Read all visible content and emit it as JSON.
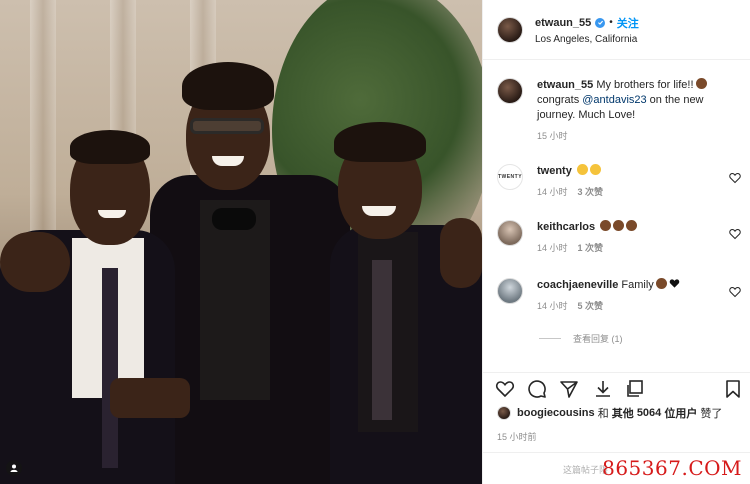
{
  "header": {
    "username": "etwaun_55",
    "follow_label": "关注",
    "location": "Los Angeles, California"
  },
  "caption": {
    "username": "etwaun_55",
    "text_before": "My brothers for life!!",
    "text_mid": "congrats ",
    "mention": "@antdavis23",
    "text_after": " on the new journey. Much Love!",
    "time": "15 小时"
  },
  "comments": [
    {
      "username": "twenty",
      "avatar_text": "TWENTY",
      "emoji": "clap-clap",
      "time": "14 小时",
      "likes": "3 次赞"
    },
    {
      "username": "keithcarlos",
      "emoji": "muscle-x3",
      "time": "14 小时",
      "likes": "1 次赞"
    },
    {
      "username": "coachjaeneville",
      "text": "Family",
      "emoji": "muscle-blackheart",
      "time": "14 小时",
      "likes": "5 次赞"
    }
  ],
  "view_replies": "查看回复 (1)",
  "likes": {
    "user": "boogiecousins",
    "and": "和",
    "others_label": "其他",
    "count": "5064",
    "unit": "位用户",
    "suffix": "赞了"
  },
  "post_time": "15 小时前",
  "add_comment_placeholder": "这篇帖子限",
  "watermark": "865367.COM",
  "icons": [
    "heart-icon",
    "comment-icon",
    "share-icon",
    "download-icon",
    "bookmark-icon",
    "verified-icon",
    "user-tag-icon"
  ],
  "colors": {
    "accent": "#0095f6",
    "verified": "#3897f0",
    "watermark": "#d61a1a"
  }
}
